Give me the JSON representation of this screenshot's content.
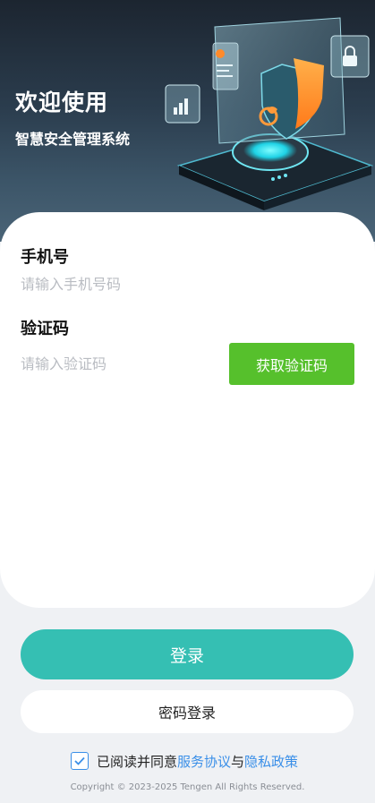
{
  "hero": {
    "title": "欢迎使用",
    "subtitle": "智慧安全管理系统"
  },
  "form": {
    "phone_label": "手机号",
    "phone_placeholder": "请输入手机号码",
    "code_label": "验证码",
    "code_placeholder": "请输入验证码",
    "get_code_button": "获取验证码"
  },
  "actions": {
    "login_button": "登录",
    "password_login_button": "密码登录"
  },
  "agreement": {
    "checked": true,
    "prefix": "已阅读并同意",
    "service_link": "服务协议",
    "and": "与",
    "privacy_link": "隐私政策"
  },
  "footer": {
    "copyright": "Copyright © 2023-2025 Tengen All Rights Reserved."
  },
  "colors": {
    "accent_teal": "#35bfb3",
    "code_button_green": "#56c02c",
    "link_blue": "#3a8fe8",
    "hero_dark": "#1c2530"
  },
  "icons": [
    "shield-icon",
    "lock-icon",
    "user-icon",
    "bar-chart-icon",
    "checkbox-checked-icon"
  ]
}
